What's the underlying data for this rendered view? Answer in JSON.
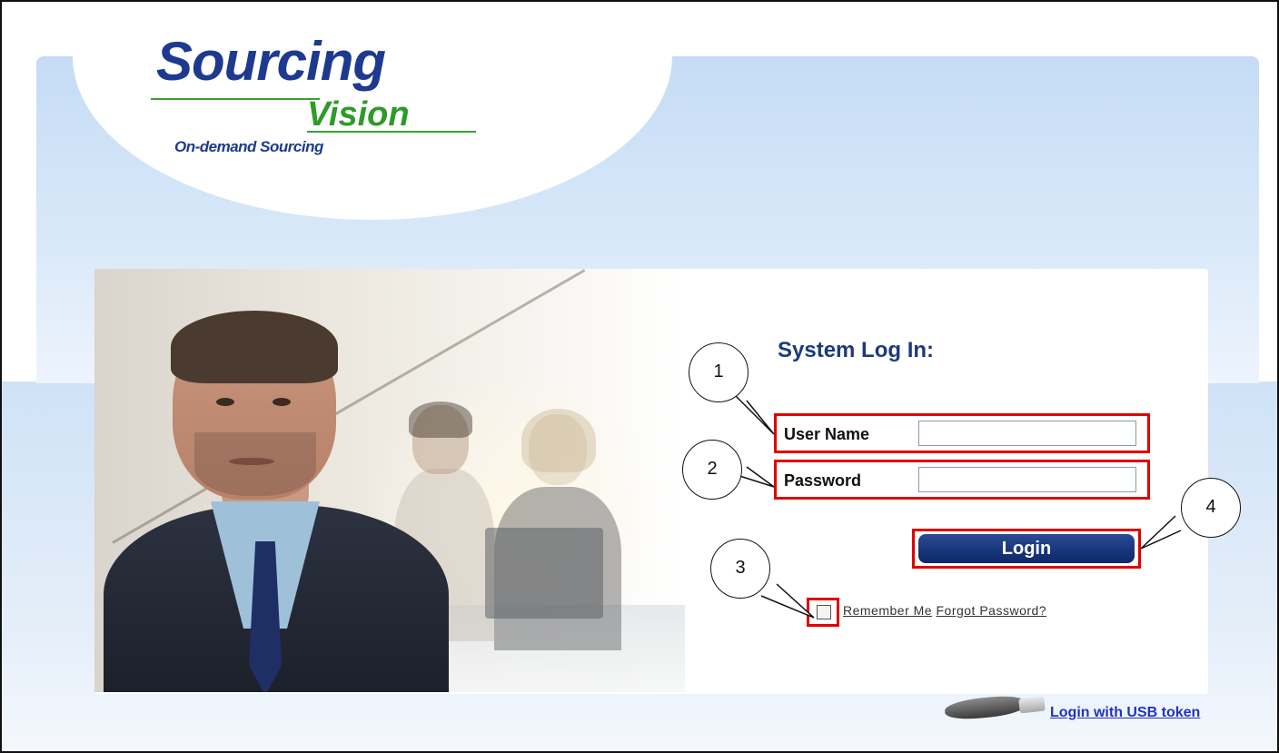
{
  "logo": {
    "brand_line1": "Sourcing",
    "brand_line2": "Vision",
    "tagline": "On-demand Sourcing"
  },
  "login_form": {
    "heading": "System Log In:",
    "username_label": "User Name",
    "username_value": "",
    "password_label": "Password",
    "password_value": "",
    "login_button": "Login",
    "remember_me": "Remember Me",
    "remember_checked": false,
    "forgot_password": "Forgot Password?",
    "usb_login": "Login with USB token"
  },
  "callouts": [
    "1",
    "2",
    "3",
    "4"
  ],
  "colors": {
    "brand_blue": "#1d3a8f",
    "brand_green": "#2f9a2a",
    "highlight_red": "#e00000",
    "button_navy": "#163478",
    "link_blue": "#2233bb"
  }
}
